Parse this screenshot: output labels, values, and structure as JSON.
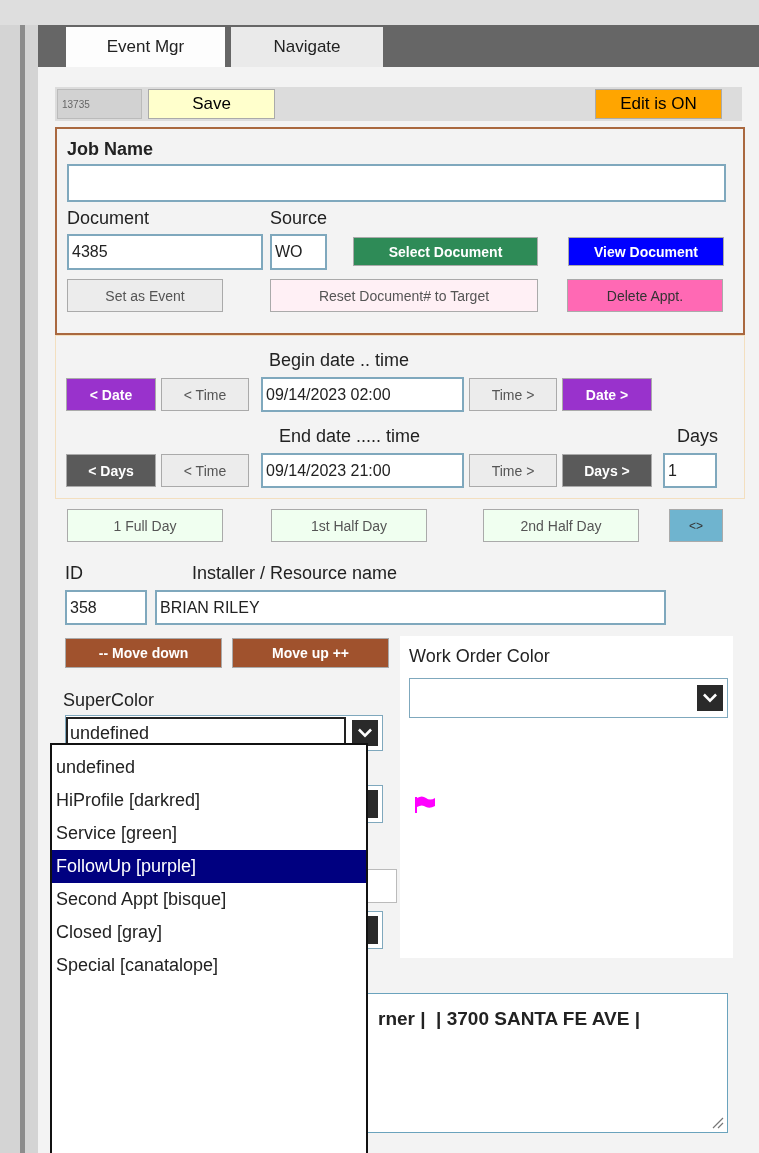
{
  "tabs": [
    {
      "label": "Event Mgr",
      "selected": true
    },
    {
      "label": "Navigate",
      "selected": false
    }
  ],
  "toolbar": {
    "record_number": "13735",
    "save": "Save",
    "edit_status": "Edit is ON"
  },
  "job": {
    "job_name_label": "Job Name",
    "document_label": "Document",
    "document": "4385",
    "source_label": "Source",
    "source": "WO",
    "buttons": [
      {
        "label": "Select Document",
        "kind": "green"
      },
      {
        "label": "View Document",
        "kind": "blue"
      }
    ],
    "actions": [
      {
        "label": "Set as Event",
        "kind": "plain"
      },
      {
        "label": "Reset Document# to Target",
        "kind": "pink"
      },
      {
        "label": "Delete Appt.",
        "kind": "magenta"
      }
    ]
  },
  "begin": {
    "label": "Begin date .. time",
    "back_big": "< Date",
    "back_small": "< Time",
    "value": "09/14/2023 02:00",
    "fwd_small": "Time >",
    "fwd_big": "Date >"
  },
  "end": {
    "label": "End date ..... time",
    "back_big": "< Days",
    "back_small": "< Time",
    "value": "09/14/2023 21:00",
    "fwd_small": "Time >",
    "fwd_big": "Days >",
    "days_label": "Days",
    "days": "1"
  },
  "presets": [
    {
      "label": "1 Full Day",
      "kind": "preset"
    },
    {
      "label": "1st Half Day",
      "kind": "preset"
    },
    {
      "label": "2nd Half Day",
      "kind": "preset"
    },
    {
      "label": "<>",
      "kind": "toggle"
    }
  ],
  "resource": {
    "id_label": "ID",
    "name_label": "Installer / Resource name",
    "id": "358",
    "name": "BRIAN RILEY"
  },
  "move": [
    "-- Move down",
    "Move up ++"
  ],
  "work_order_color": {
    "label": "Work Order Color"
  },
  "supercolor": {
    "label": "SuperColor",
    "value": "undefined",
    "options": [
      {
        "label": "undefined",
        "highlighted": false
      },
      {
        "label": "HiProfile [darkred]",
        "highlighted": false
      },
      {
        "label": "Service [green]",
        "highlighted": false
      },
      {
        "label": "FollowUp [purple]",
        "highlighted": true
      },
      {
        "label": "Second Appt [bisque]",
        "highlighted": false
      },
      {
        "label": "Closed [gray]",
        "highlighted": false
      },
      {
        "label": "Special [canatalope]",
        "highlighted": false
      }
    ]
  },
  "notes": "rner |  | 3700 SANTA FE AVE |"
}
